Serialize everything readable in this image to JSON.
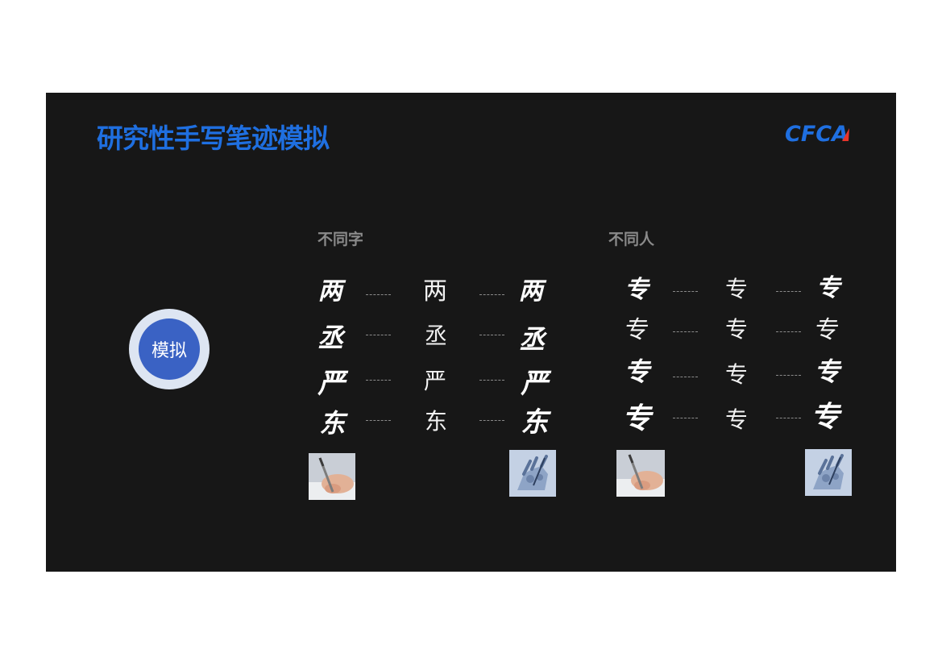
{
  "slide": {
    "title": "研究性手写笔迹模拟",
    "logo": "CFCA",
    "badge_label": "模拟",
    "sections": [
      {
        "heading": "不同字",
        "rows": [
          {
            "human": "两",
            "standard": "两",
            "machine": "两"
          },
          {
            "human": "丞",
            "standard": "丞",
            "machine": "丞"
          },
          {
            "human": "严",
            "standard": "严",
            "machine": "严"
          },
          {
            "human": "东",
            "standard": "东",
            "machine": "东"
          }
        ],
        "images": [
          "hand-writing-photo",
          "robot-hand-photo"
        ]
      },
      {
        "heading": "不同人",
        "rows": [
          {
            "human": "专",
            "standard": "专",
            "machine": "专"
          },
          {
            "human": "专",
            "standard": "专",
            "machine": "专"
          },
          {
            "human": "专",
            "standard": "专",
            "machine": "专"
          },
          {
            "human": "专",
            "standard": "专",
            "machine": "专"
          }
        ],
        "images": [
          "hand-writing-photo",
          "robot-hand-photo"
        ]
      }
    ],
    "colors": {
      "background": "#171717",
      "title": "#1f6fe0",
      "badge_fill": "#3a62c4",
      "badge_ring": "#dde5f2",
      "heading": "#8a8a8a",
      "logo_accent": "#e8352b"
    }
  }
}
